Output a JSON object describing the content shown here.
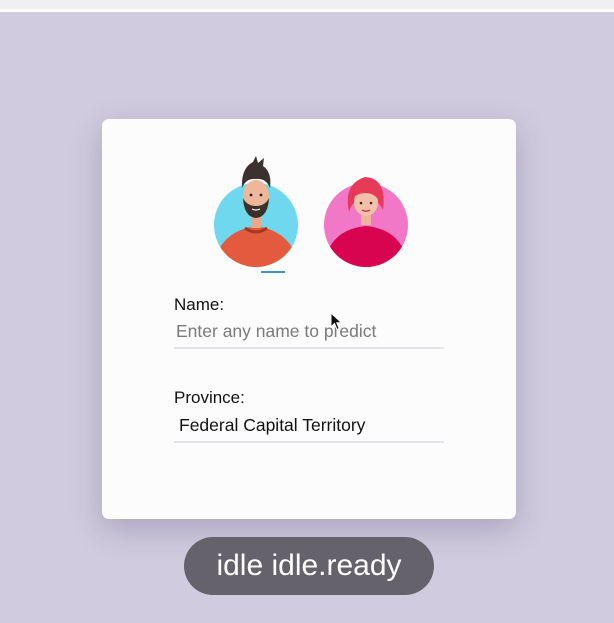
{
  "form": {
    "name_label": "Name:",
    "name_value": "",
    "name_placeholder": "Enter any name to predict",
    "province_label": "Province:",
    "province_value": "Federal Capital Territory"
  },
  "status": {
    "text": "idle idle.ready"
  },
  "illustration": {
    "male_bg": "#6fd8ef",
    "male_shirt": "#e35a3e",
    "female_bg": "#f178c6",
    "female_shirt": "#d8044f",
    "female_hair": "#e63a57"
  },
  "icons": [
    "male-avatar-icon",
    "female-avatar-icon",
    "mouse-pointer-icon"
  ]
}
